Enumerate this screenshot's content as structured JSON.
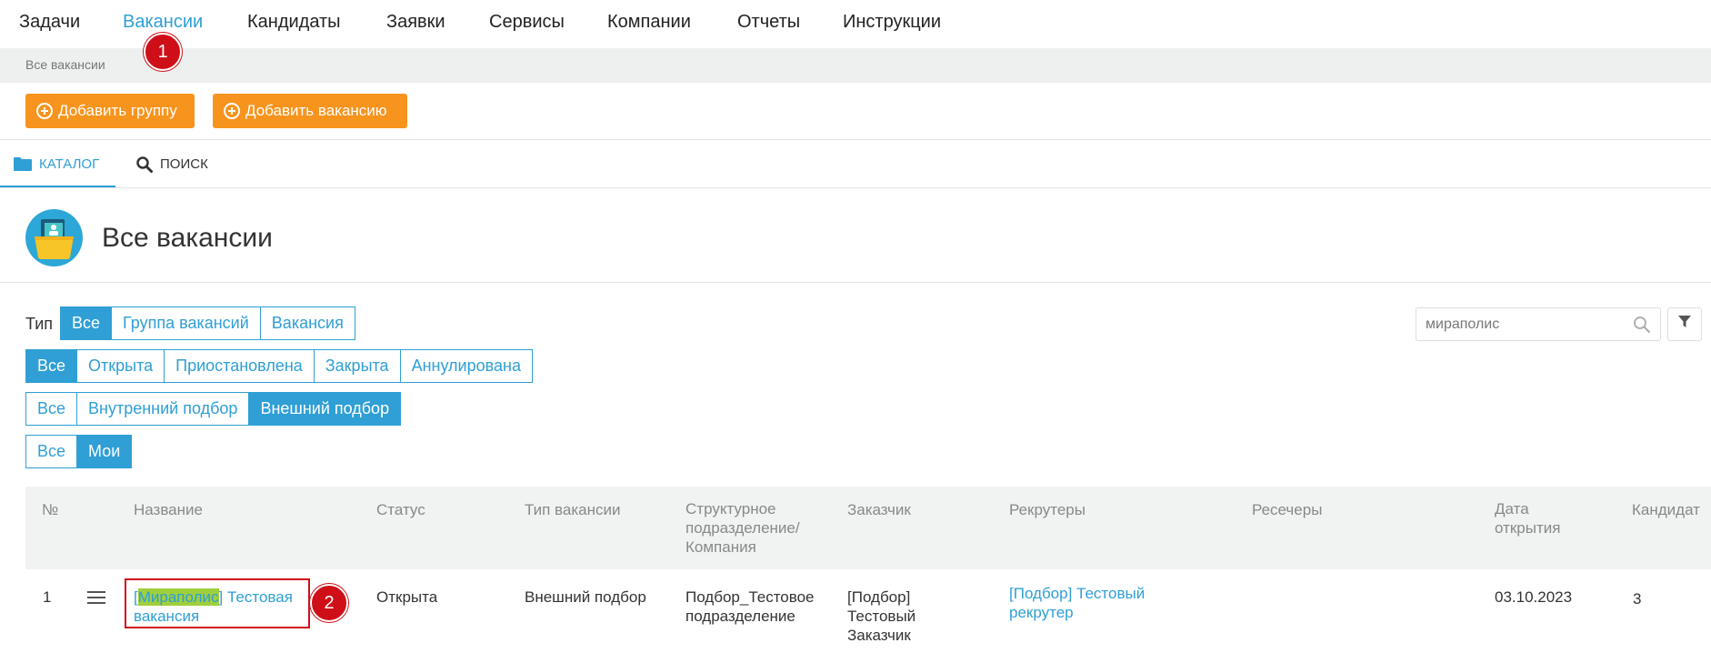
{
  "nav": {
    "items": [
      "Задачи",
      "Вакансии",
      "Кандидаты",
      "Заявки",
      "Сервисы",
      "Компании",
      "Отчеты",
      "Инструкции"
    ],
    "active_index": 1
  },
  "breadcrumb": "Все вакансии",
  "markers": [
    "1",
    "2"
  ],
  "toolbar": {
    "add_group": "Добавить группу",
    "add_vacancy": "Добавить вакансию"
  },
  "tabs": {
    "catalog": "Каталог",
    "search": "Поиск"
  },
  "page_title": "Все вакансии",
  "filters": {
    "type_label": "Тип",
    "type_options": [
      "Все",
      "Группа вакансий",
      "Вакансия"
    ],
    "status_options": [
      "Все",
      "Открыта",
      "Приостановлена",
      "Закрыта",
      "Аннулирована"
    ],
    "selection_options": [
      "Все",
      "Внутренний подбор",
      "Внешний подбор"
    ],
    "owner_options": [
      "Все",
      "Мои"
    ]
  },
  "search": {
    "value": "мираполис"
  },
  "table": {
    "headers": {
      "num": "№",
      "name": "Название",
      "status": "Статус",
      "vacancy_type": "Тип вакансии",
      "unit_1": "Структурное",
      "unit_2": "подразделение/",
      "unit_3": "Компания",
      "customer": "Заказчик",
      "recruiters": "Рекрутеры",
      "researchers": "Ресечеры",
      "opened_1": "Дата",
      "opened_2": "открытия",
      "candidates": "Кандидат"
    },
    "rows": [
      {
        "num": "1",
        "name_prefix": "[",
        "name_highlight": "Мираполис",
        "name_rest": "] Тестовая",
        "name_line2": "вакансия",
        "status": "Открыта",
        "vacancy_type": "Внешний подбор",
        "unit_1": "Подбор_Тестовое",
        "unit_2": "подразделение",
        "customer_1": "[Подбор]",
        "customer_2": "Тестовый",
        "customer_3": "Заказчик",
        "recruiter_1": "[Подбор] Тестовый",
        "recruiter_2": "рекрутер",
        "researchers": "",
        "opened": "03.10.2023",
        "candidates": "3"
      }
    ]
  },
  "colors": {
    "accent": "#2f9fd5",
    "orange": "#f7941d",
    "marker": "#cf0f18",
    "highlight": "#9fd03b"
  }
}
